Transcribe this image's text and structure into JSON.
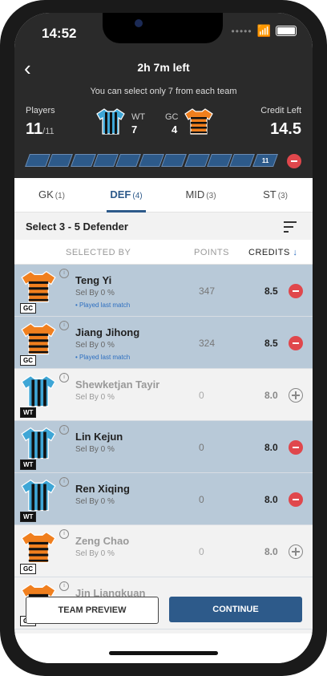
{
  "status": {
    "time": "14:52"
  },
  "header": {
    "title": "2h 7m left",
    "subtitle": "You can select only 7 from each team",
    "players_label": "Players",
    "players_count": "11",
    "players_max": "/11",
    "credit_label": "Credit Left",
    "credit_value": "14.5",
    "teams": [
      {
        "code": "WT",
        "count": "7"
      },
      {
        "code": "GC",
        "count": "4"
      }
    ],
    "progress_label": "11"
  },
  "tabs": [
    {
      "label": "GK",
      "count": "(1)"
    },
    {
      "label": "DEF",
      "count": "(4)"
    },
    {
      "label": "MID",
      "count": "(3)"
    },
    {
      "label": "ST",
      "count": "(3)"
    }
  ],
  "select_text": "Select 3 - 5 Defender",
  "columns": {
    "selected_by": "SELECTED BY",
    "points": "POINTS",
    "credits": "CREDITS",
    "sort_arrow": "↓"
  },
  "players": [
    {
      "name": "Teng Yi",
      "sel": "Sel By 0 %",
      "played": "Played last match",
      "points": "347",
      "credits": "8.5",
      "team": "GC",
      "selected": true
    },
    {
      "name": "Jiang Jihong",
      "sel": "Sel By 0 %",
      "played": "Played last match",
      "points": "324",
      "credits": "8.5",
      "team": "GC",
      "selected": true
    },
    {
      "name": "Shewketjan Tayir",
      "sel": "Sel By 0 %",
      "points": "0",
      "credits": "8.0",
      "team": "WT",
      "selected": false
    },
    {
      "name": "Lin Kejun",
      "sel": "Sel By 0 %",
      "points": "0",
      "credits": "8.0",
      "team": "WT",
      "selected": true
    },
    {
      "name": "Ren Xiqing",
      "sel": "Sel By 0 %",
      "points": "0",
      "credits": "8.0",
      "team": "WT",
      "selected": true
    },
    {
      "name": "Zeng Chao",
      "sel": "Sel By 0 %",
      "points": "0",
      "credits": "8.0",
      "team": "GC",
      "selected": false
    },
    {
      "name": "Jin Liangkuan",
      "sel": "",
      "points": "",
      "credits": "",
      "team": "GC",
      "selected": false
    }
  ],
  "buttons": {
    "preview": "TEAM PREVIEW",
    "continue": "CONTINUE"
  },
  "colors": {
    "accent": "#2d5a8a",
    "selected_row": "#b8c9d8",
    "remove": "#e0474c",
    "gc_orange": "#f07f1e",
    "wt_blue": "#3ea6d6"
  },
  "icons": {
    "info": "i"
  }
}
